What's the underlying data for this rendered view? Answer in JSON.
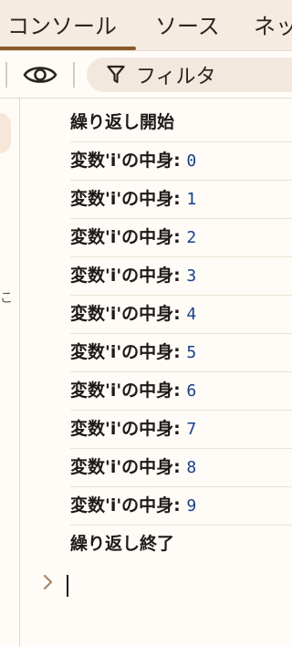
{
  "tabs": [
    {
      "label": "コンソール",
      "active": true
    },
    {
      "label": "ソース",
      "active": false
    },
    {
      "label": "ネッ",
      "active": false
    }
  ],
  "toolbar": {
    "eye_icon": "eye-icon",
    "filter_icon": "funnel-icon",
    "filter_placeholder": "フィルタ"
  },
  "console": {
    "messages": [
      {
        "text": "繰り返し開始",
        "value": ""
      },
      {
        "text": "変数'i'の中身",
        "sep": ":",
        "value": "0"
      },
      {
        "text": "変数'i'の中身",
        "sep": ":",
        "value": "1"
      },
      {
        "text": "変数'i'の中身",
        "sep": ":",
        "value": "2"
      },
      {
        "text": "変数'i'の中身",
        "sep": ":",
        "value": "3"
      },
      {
        "text": "変数'i'の中身",
        "sep": ":",
        "value": "4"
      },
      {
        "text": "変数'i'の中身",
        "sep": ":",
        "value": "5"
      },
      {
        "text": "変数'i'の中身",
        "sep": ":",
        "value": "6"
      },
      {
        "text": "変数'i'の中身",
        "sep": ":",
        "value": "7"
      },
      {
        "text": "変数'i'の中身",
        "sep": ":",
        "value": "8"
      },
      {
        "text": "変数'i'の中身",
        "sep": ":",
        "value": "9"
      },
      {
        "text": "繰り返し終了",
        "value": ""
      }
    ],
    "prompt_icon": "chevron-right-icon"
  },
  "sidebar": {
    "partial_label": "こ"
  },
  "colors": {
    "accent": "#8a5a2a",
    "value_text": "#1a3f8a",
    "tabbar_bg": "#f6ebe1"
  }
}
